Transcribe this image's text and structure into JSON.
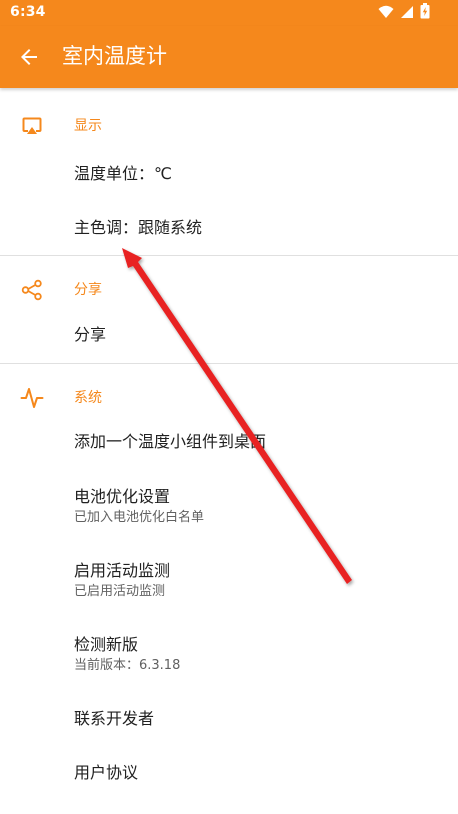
{
  "status_bar": {
    "time": "6:34",
    "icons": [
      "wifi-icon",
      "signal-icon",
      "battery-charging-icon"
    ]
  },
  "app_bar": {
    "back_icon": "arrow-left-icon",
    "title": "室内温度计",
    "background_color": "#f5881c"
  },
  "accent_color": "#f5881c",
  "sections": {
    "display": {
      "icon": "cast-screen-icon",
      "title": "显示",
      "items": [
        {
          "title": "温度单位：℃"
        },
        {
          "title": "主色调：跟随系统"
        }
      ]
    },
    "share": {
      "icon": "share-icon",
      "title": "分享",
      "items": [
        {
          "title": "分享"
        }
      ]
    },
    "system": {
      "icon": "pulse-icon",
      "title": "系统",
      "items": [
        {
          "title": "添加一个温度小组件到桌面"
        },
        {
          "title": "电池优化设置",
          "summary": "已加入电池优化白名单"
        },
        {
          "title": "启用活动监测",
          "summary": "已启用活动监测"
        },
        {
          "title": "检测新版",
          "summary": "当前版本：6.3.18"
        },
        {
          "title": "联系开发者"
        },
        {
          "title": "用户协议"
        }
      ]
    }
  },
  "annotation": {
    "icon": "red-arrow-icon",
    "color": "#e82020"
  }
}
